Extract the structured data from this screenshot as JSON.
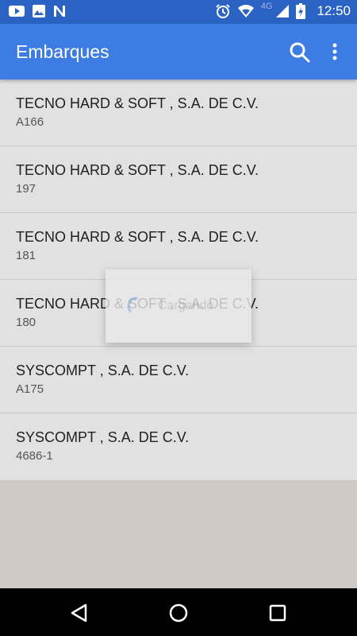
{
  "status_bar": {
    "time": "12:50",
    "network": "4G",
    "left_icons": [
      "youtube-icon",
      "image-icon",
      "n-app-icon"
    ],
    "right_icons": [
      "alarm-icon",
      "wifi-icon",
      "cell-signal-icon",
      "battery-icon"
    ]
  },
  "app_bar": {
    "title": "Embarques",
    "icons": [
      "search-icon",
      "more-vert-icon"
    ]
  },
  "shipments": [
    {
      "company": "TECNO HARD & SOFT , S.A. DE C.V.",
      "code": "A166"
    },
    {
      "company": "TECNO HARD & SOFT , S.A. DE C.V.",
      "code": "197"
    },
    {
      "company": "TECNO HARD & SOFT , S.A. DE C.V.",
      "code": "181"
    },
    {
      "company": "TECNO HARD & SOFT , S.A. DE C.V.",
      "code": "180"
    },
    {
      "company": "SYSCOMPT , S.A. DE C.V.",
      "code": "A175"
    },
    {
      "company": "SYSCOMPT , S.A. DE C.V.",
      "code": "4686-1"
    }
  ],
  "loading_dialog": {
    "text": "Cargando"
  },
  "nav_bar": {
    "icons": [
      "back-icon",
      "home-icon",
      "recents-icon"
    ]
  },
  "colors": {
    "status_bar": "#2b63c4",
    "app_bar": "#3d7de3",
    "list_bg": "#e1e1e1",
    "empty_bg": "#d0cac6",
    "spinner": "#3d7de3"
  }
}
